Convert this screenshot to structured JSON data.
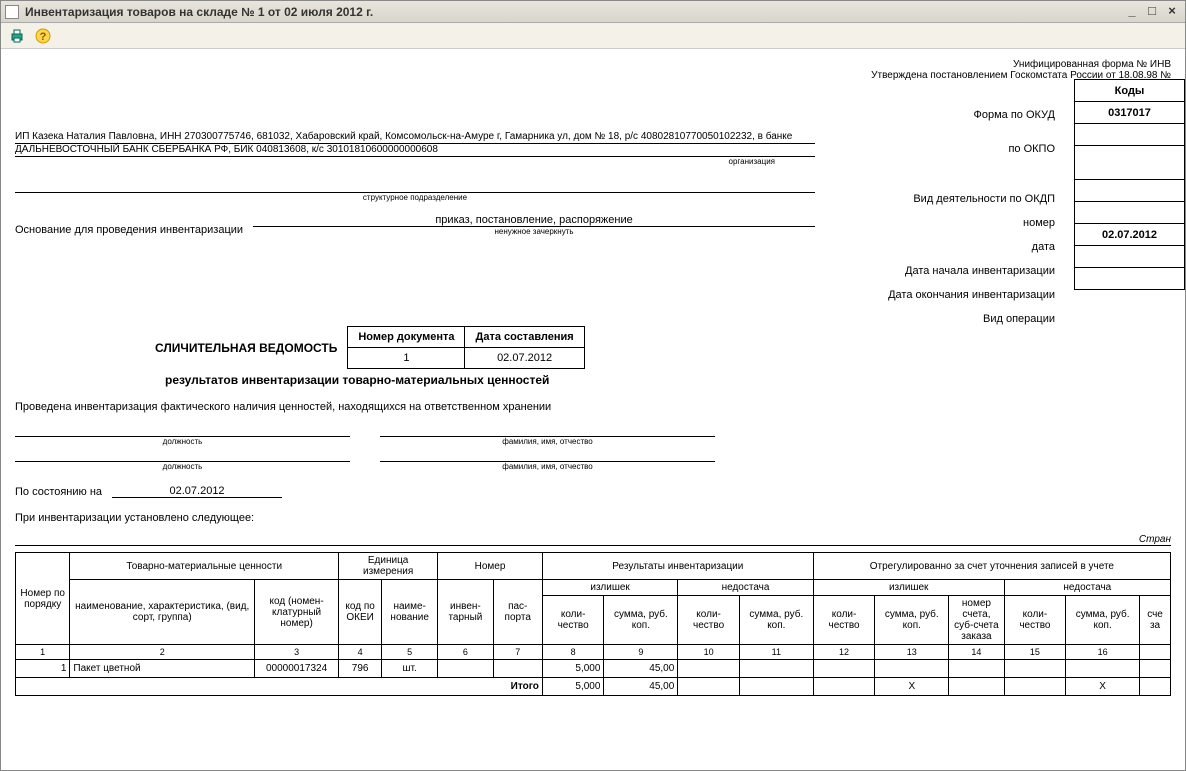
{
  "window": {
    "title": "Инвентаризация товаров на складе № 1 от 02 июля 2012 г."
  },
  "header": {
    "form_note": "Унифицированная форма № ИНВ",
    "approved": "Утверждена постановлением Госкомстата России от 18.08.98 №"
  },
  "codes": {
    "header": "Коды",
    "okud_label": "Форма по ОКУД",
    "okud": "0317017",
    "okpo_label": "по ОКПО",
    "okpo": "",
    "okdp_label": "Вид деятельности по ОКДП",
    "okdp": "",
    "number_label": "номер",
    "number": "",
    "date_label": "дата",
    "date": "",
    "start_label": "Дата начала инвентаризации",
    "start": "02.07.2012",
    "end_label": "Дата окончания инвентаризации",
    "end": "",
    "optype_label": "Вид операции",
    "optype": ""
  },
  "org": {
    "line1": "ИП Казека Наталия Павловна, ИНН 270300775746, 681032, Хабаровский край, Комсомольск-на-Амуре г, Гамарника ул, дом № 18, р/с 40802810770050102232, в банке",
    "line2": "ДАЛЬНЕВОСТОЧНЫЙ БАНК СБЕРБАНКА РФ, БИК 040813608, к/с 30101810600000000608",
    "sub1": "организация",
    "sub2": "структурное подразделение"
  },
  "basis": {
    "label": "Основание для проведения инвентаризации",
    "value": "приказ, постановление, распоряжение",
    "sub": "ненужное зачеркнуть"
  },
  "docnum": {
    "title": "СЛИЧИТЕЛЬНАЯ ВЕДОМОСТЬ",
    "col1": "Номер документа",
    "col2": "Дата составления",
    "num": "1",
    "date": "02.07.2012",
    "subtitle": "результатов инвентаризации товарно-материальных ценностей"
  },
  "intro": "Проведена инвентаризация фактического наличия ценностей, находящихся на ответственном хранении",
  "sign": {
    "pos": "должность",
    "fio": "фамилия, имя, отчество"
  },
  "state": {
    "label": "По состоянию на",
    "value": "02.07.2012"
  },
  "found": "При инвентаризации установлено следующее:",
  "page": "Стран",
  "table": {
    "h_num": "Номер по порядку",
    "h_tmc": "Товарно-материальные ценности",
    "h_unit": "Единица измерения",
    "h_number": "Номер",
    "h_results": "Результаты инвентаризации",
    "h_adjust": "Отрегулированно за счет уточнения записей в учете",
    "h_name": "наименование, характеристика, (вид, сорт, группа)",
    "h_code": "код (номен-клатурный номер)",
    "h_okei": "код по ОКЕИ",
    "h_unitname": "наиме-нование",
    "h_invnum": "инвен-тарный",
    "h_passport": "пас-порта",
    "h_surplus": "излишек",
    "h_shortage": "недостача",
    "h_qty": "коли-чество",
    "h_sum": "сумма, руб. коп.",
    "h_acct": "номер счета, суб-счета заказа",
    "h_acct2": "сче за",
    "cols": [
      "1",
      "2",
      "3",
      "4",
      "5",
      "6",
      "7",
      "8",
      "9",
      "10",
      "11",
      "12",
      "13",
      "14",
      "15",
      "16",
      ""
    ],
    "rows": [
      {
        "n": "1",
        "name": "Пакет цветной",
        "code": "00000017324",
        "okei": "796",
        "unit": "шт.",
        "inv": "",
        "pass": "",
        "sq": "5,000",
        "ss": "45,00",
        "dq": "",
        "ds": "",
        "aq": "",
        "as": "",
        "acc": "",
        "bq": "",
        "bs": "",
        "bacc": ""
      }
    ],
    "total_label": "Итого",
    "totals": {
      "sq": "5,000",
      "ss": "45,00",
      "dq": "",
      "ds": "",
      "aq": "",
      "as": "X",
      "acc": "",
      "bq": "",
      "bs": "X",
      "bacc": ""
    }
  }
}
